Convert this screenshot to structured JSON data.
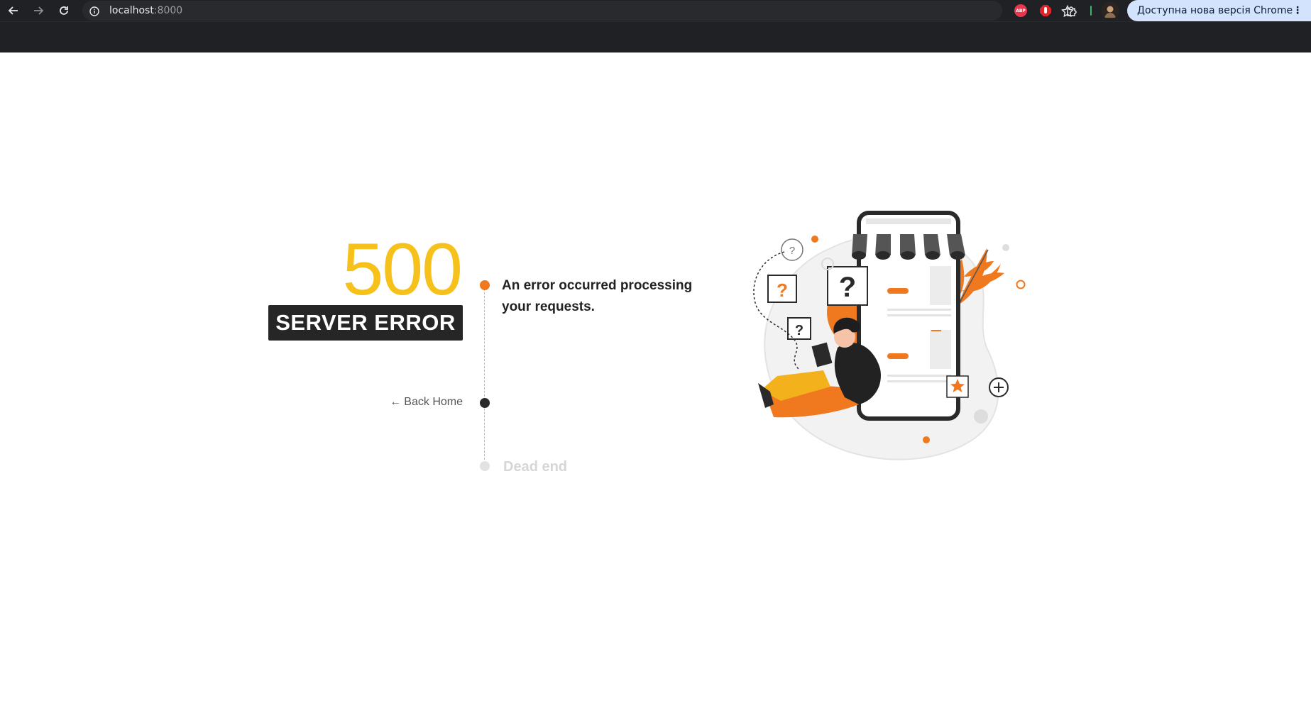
{
  "browser": {
    "url_host": "localhost",
    "url_port": ":8000",
    "update_label": "Доступна нова версія Chrome",
    "update_menu": "⋮",
    "ext_abp_label": "ABP",
    "icons": [
      "back-arrow-icon",
      "forward-arrow-icon",
      "reload-icon",
      "info-icon",
      "star-icon",
      "adblock-plus-icon",
      "stop-hand-icon",
      "puzzle-icon",
      "profile-avatar"
    ]
  },
  "page": {
    "code": "500",
    "badge": "SERVER ERROR",
    "message": "An error occurred processing your requests.",
    "back_arrow": "←",
    "back_label": "Back Home",
    "dead_end": "Dead end"
  },
  "colors": {
    "code_yellow": "#f5c11a",
    "accent_orange": "#f0781e",
    "badge_dark": "#262626",
    "chrome_dark": "#202124",
    "update_pill": "#d3e3fd"
  }
}
